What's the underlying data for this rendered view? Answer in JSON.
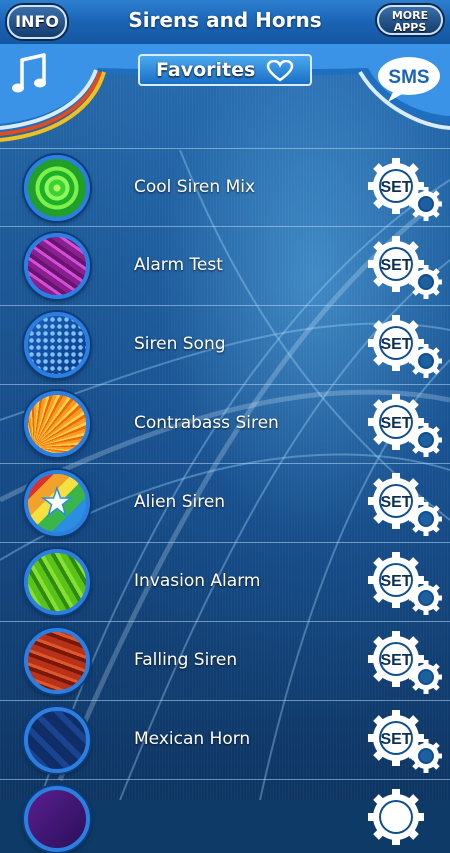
{
  "header": {
    "title": "Sirens and Horns",
    "info_label": "INFO",
    "more_apps_line1": "MORE",
    "more_apps_line2": "APPS"
  },
  "toolbar": {
    "favorites_label": "Favorites",
    "sms_label": "SMS"
  },
  "set_label": "SET",
  "sounds": [
    {
      "name": "Cool Siren Mix",
      "thumb": "green-flower-pattern"
    },
    {
      "name": "Alarm Test",
      "thumb": "purple-swirl-pattern"
    },
    {
      "name": "Siren Song",
      "thumb": "blue-dots-pattern"
    },
    {
      "name": "Contrabass Siren",
      "thumb": "orange-rays-pattern"
    },
    {
      "name": "Alien Siren",
      "thumb": "rainbow-star-pattern"
    },
    {
      "name": "Invasion Alarm",
      "thumb": "green-stripes-pattern"
    },
    {
      "name": "Falling Siren",
      "thumb": "red-waves-pattern"
    },
    {
      "name": "Mexican Horn",
      "thumb": "navy-stripes-pattern"
    }
  ],
  "colors": {
    "accent": "#2c7fe0",
    "header": "#1a64b5"
  }
}
